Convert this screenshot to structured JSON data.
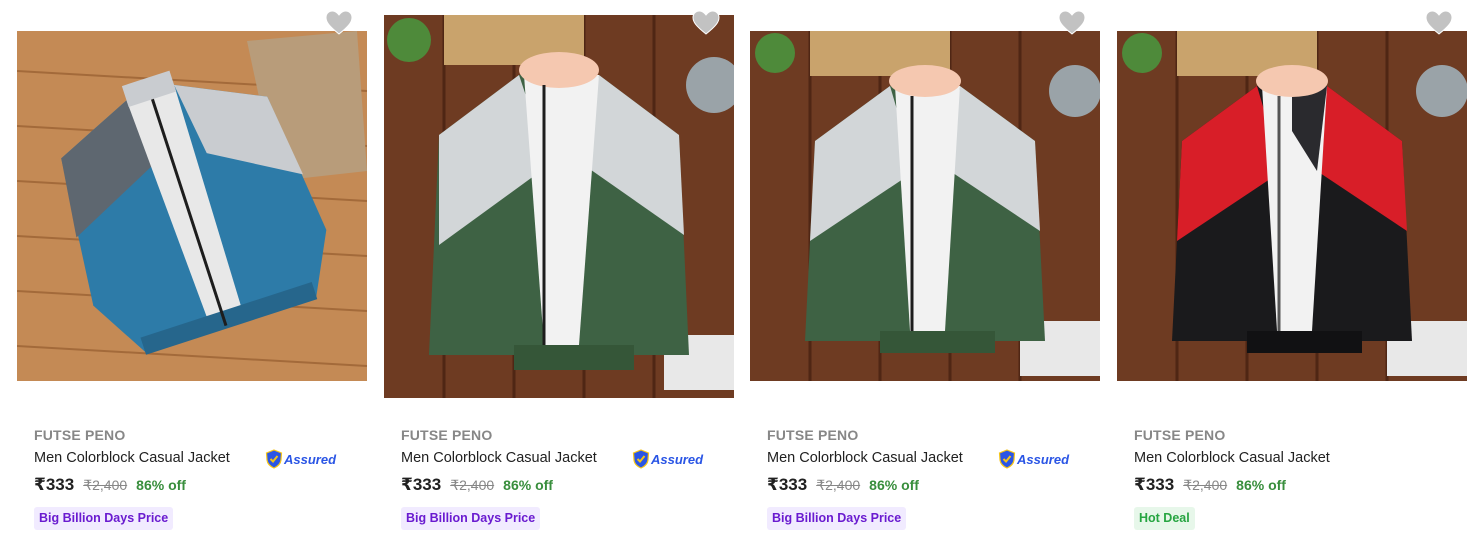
{
  "products": [
    {
      "brand": "FUTSE PENO",
      "title": "Men Colorblock Casual Jacket",
      "assured": true,
      "assured_label": "Assured",
      "price": "₹333",
      "mrp": "₹2,400",
      "discount": "86% off",
      "badge": "Big Billion Days Price",
      "image": {
        "jacket_colors": [
          "#2d7ba8",
          "#c9ccd0",
          "#5e6770"
        ],
        "background": "#c48a55"
      }
    },
    {
      "brand": "FUTSE PENO",
      "title": "Men Colorblock Casual Jacket",
      "assured": true,
      "assured_label": "Assured",
      "price": "₹333",
      "mrp": "₹2,400",
      "discount": "86% off",
      "badge": "Big Billion Days Price",
      "image": {
        "jacket_colors": [
          "#3e6244",
          "#d2d6d8",
          "#8a8f93"
        ],
        "background": "#6e3b22"
      }
    },
    {
      "brand": "FUTSE PENO",
      "title": "Men Colorblock Casual Jacket",
      "assured": true,
      "assured_label": "Assured",
      "price": "₹333",
      "mrp": "₹2,400",
      "discount": "86% off",
      "badge": "Big Billion Days Price",
      "image": {
        "jacket_colors": [
          "#3e6244",
          "#d2d6d8",
          "#8a8f93"
        ],
        "background": "#6e3b22"
      }
    },
    {
      "brand": "FUTSE PENO",
      "title": "Men Colorblock Casual Jacket",
      "assured": false,
      "assured_label": "",
      "price": "₹333",
      "mrp": "₹2,400",
      "discount": "86% off",
      "badge": "Hot Deal",
      "image": {
        "jacket_colors": [
          "#1a1a1c",
          "#d81e28",
          "#2a2a2e"
        ],
        "background": "#6e3b22"
      }
    }
  ],
  "colors": {
    "assured_blue": "#2a55e5",
    "discount_green": "#388e3c",
    "bbd_purple": "#6a1bd0",
    "hot_green": "#26a541",
    "wishlist_gray": "#c2c2c2"
  },
  "icons": {
    "wishlist": "heart-icon",
    "assured": "shield-check-icon"
  }
}
